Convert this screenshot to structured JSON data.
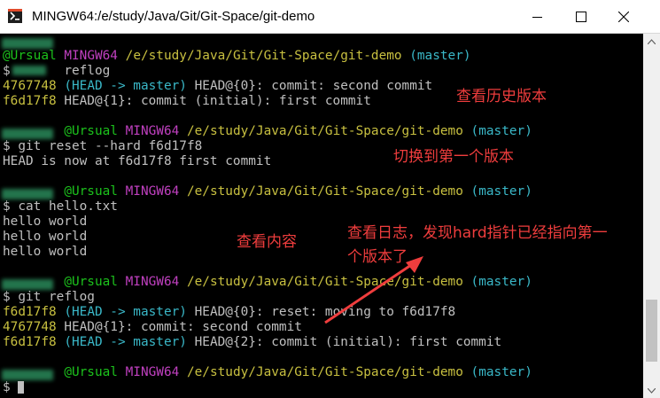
{
  "window": {
    "title": "MINGW64:/e/study/Java/Git/Git-Space/git-demo",
    "controls": [
      "minimize",
      "maximize",
      "close"
    ]
  },
  "prompt": {
    "user_host": "@Ursual",
    "shell": "MINGW64",
    "path": "/e/study/Java/Git/Git-Space/git-demo",
    "branch": "(master)",
    "symbol": "$"
  },
  "blocks": [
    {
      "command": " reflog",
      "output": [
        {
          "hash": "4767748",
          "ref": "(HEAD -> master)",
          "text": " HEAD@{0}: commit: second commit"
        },
        {
          "hash": "f6d17f8",
          "ref": "",
          "text": " HEAD@{1}: commit (initial): first commit"
        }
      ]
    },
    {
      "command": " git reset --hard f6d17f8",
      "output_plain": [
        "HEAD is now at f6d17f8 first commit"
      ]
    },
    {
      "command": " cat hello.txt",
      "output_plain": [
        "hello world",
        "hello world",
        "hello world"
      ]
    },
    {
      "command": " git reflog",
      "output": [
        {
          "hash": "f6d17f8",
          "ref": "(HEAD -> master)",
          "text": " HEAD@{0}: reset: moving to f6d17f8"
        },
        {
          "hash": "4767748",
          "ref": "",
          "text": " HEAD@{1}: commit: second commit"
        },
        {
          "hash": "f6d17f8",
          "ref": "(HEAD -> master)",
          "text": " HEAD@{2}: commit (initial): first commit"
        }
      ]
    }
  ],
  "annotations": {
    "history": "查看历史版本",
    "switch": "切换到第一个版本",
    "content": "查看内容",
    "log_line1": "查看日志，发现hard指针已经指向第一",
    "log_line2": "个版本了"
  },
  "colors": {
    "annotation": "#ef3d3d",
    "hash": "#c8c040",
    "ref": "#3ab8c8",
    "user": "#1cc21c",
    "shell": "#c040c0"
  }
}
